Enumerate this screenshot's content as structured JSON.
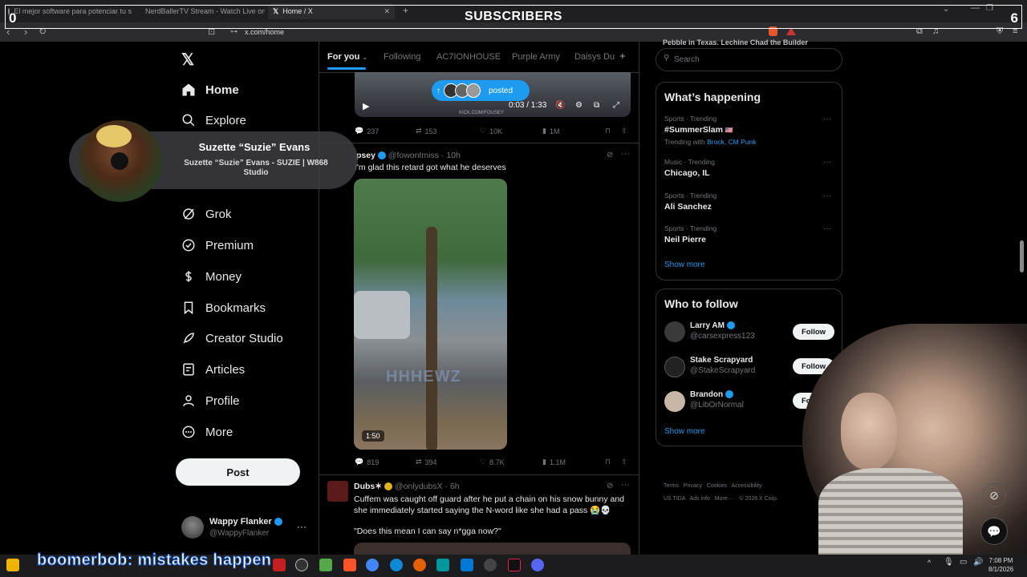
{
  "overlay": {
    "title": "SUBSCRIBERS",
    "left_count": "0",
    "right_count": "6"
  },
  "browser": {
    "tabs": [
      {
        "label": "El mejor software para potenciar tu s"
      },
      {
        "label": "NerdBallerTV Stream - Watch Live on"
      },
      {
        "label": "Home / X"
      }
    ],
    "url": "x.com/home"
  },
  "sidebar": {
    "items": [
      {
        "label": "Home",
        "icon": "home-icon"
      },
      {
        "label": "Explore",
        "icon": "search-icon"
      },
      {
        "label": "Grok",
        "icon": "grok-icon"
      },
      {
        "label": "Premium",
        "icon": "premium-icon"
      },
      {
        "label": "Money",
        "icon": "money-icon"
      },
      {
        "label": "Bookmarks",
        "icon": "bookmark-icon"
      },
      {
        "label": "Creator Studio",
        "icon": "rocket-icon"
      },
      {
        "label": "Articles",
        "icon": "article-icon"
      },
      {
        "label": "Profile",
        "icon": "profile-icon"
      },
      {
        "label": "More",
        "icon": "more-icon"
      }
    ],
    "post_label": "Post",
    "account": {
      "name": "Wappy Flanker",
      "handle": "@WappyFlanker"
    }
  },
  "notification": {
    "name": "Suzette “Suzie” Evans",
    "subtitle": "Suzette “Suzie” Evans - SUZIE | W868 Studio"
  },
  "feed": {
    "tabs": [
      "For you",
      "Following",
      "AC7IONHOUSE",
      "Purple Army",
      "Daisys Du"
    ],
    "video_banner": {
      "label": "posted",
      "time": "0:03 / 1:33",
      "watermark": "KICK.COM/FOUSEY"
    },
    "tweet1_stats": {
      "replies": "237",
      "reposts": "153",
      "likes": "10K",
      "views": "1M"
    },
    "tweet2": {
      "name": "psey",
      "handle": "@fowontmiss",
      "time": "10h",
      "text": "I'm glad this retard got what he deserves",
      "video_duration": "1:50",
      "watermark": "HHHEWZ",
      "stats": {
        "replies": "819",
        "reposts": "394",
        "likes": "8.7K",
        "views": "1.1M"
      }
    },
    "tweet3": {
      "name": "Dubs✶",
      "handle": "@onlydubsX",
      "time": "6h",
      "text": "Cuffem was caught off guard after he put a chain on his snow bunny and she immediately started saying the N-word like she had a pass 😭💀",
      "quote": "\"Does this mean I can say n*gga now?\""
    }
  },
  "right": {
    "top_text": "Pebble in Texas. Lechine Chad the Builder",
    "search_placeholder": "Search",
    "happening": {
      "title": "What’s happening",
      "trends": [
        {
          "meta": "Sports · Trending",
          "name": "#SummerSlam",
          "extra_prefix": "Trending with ",
          "extra_links": "Brock, CM Punk"
        },
        {
          "meta": "Music · Trending",
          "name": "Chicago, IL"
        },
        {
          "meta": "Sports · Trending",
          "name": "Ali Sanchez"
        },
        {
          "meta": "Sports · Trending",
          "name": "Neil Pierre"
        }
      ],
      "show_more": "Show more"
    },
    "who_to_follow": {
      "title": "Who to follow",
      "users": [
        {
          "name": "Larry AM",
          "handle": "@carsexpress123",
          "button": "Follow"
        },
        {
          "name": "Stake Scrapyard",
          "handle": "@StakeScrapyard",
          "button": "Follow"
        },
        {
          "name": "Brandon",
          "handle": "@LibOrNormal",
          "button": "Follow"
        }
      ],
      "show_more": "Show more"
    },
    "footer": {
      "links": [
        "Terms",
        "Privacy",
        "Cookies",
        "Accessibility",
        "US TIDA",
        "Ads info",
        "More ···",
        "© 2026 X Corp."
      ]
    }
  },
  "ticker": {
    "text": "boomerbob: mistakes happen"
  },
  "taskbar": {
    "time": "7:08 PM",
    "date": "8/1/2026"
  },
  "colors": {
    "accent": "#1d9bf0",
    "background": "#000000",
    "text": "#e7e9ea",
    "muted": "#71767b"
  }
}
